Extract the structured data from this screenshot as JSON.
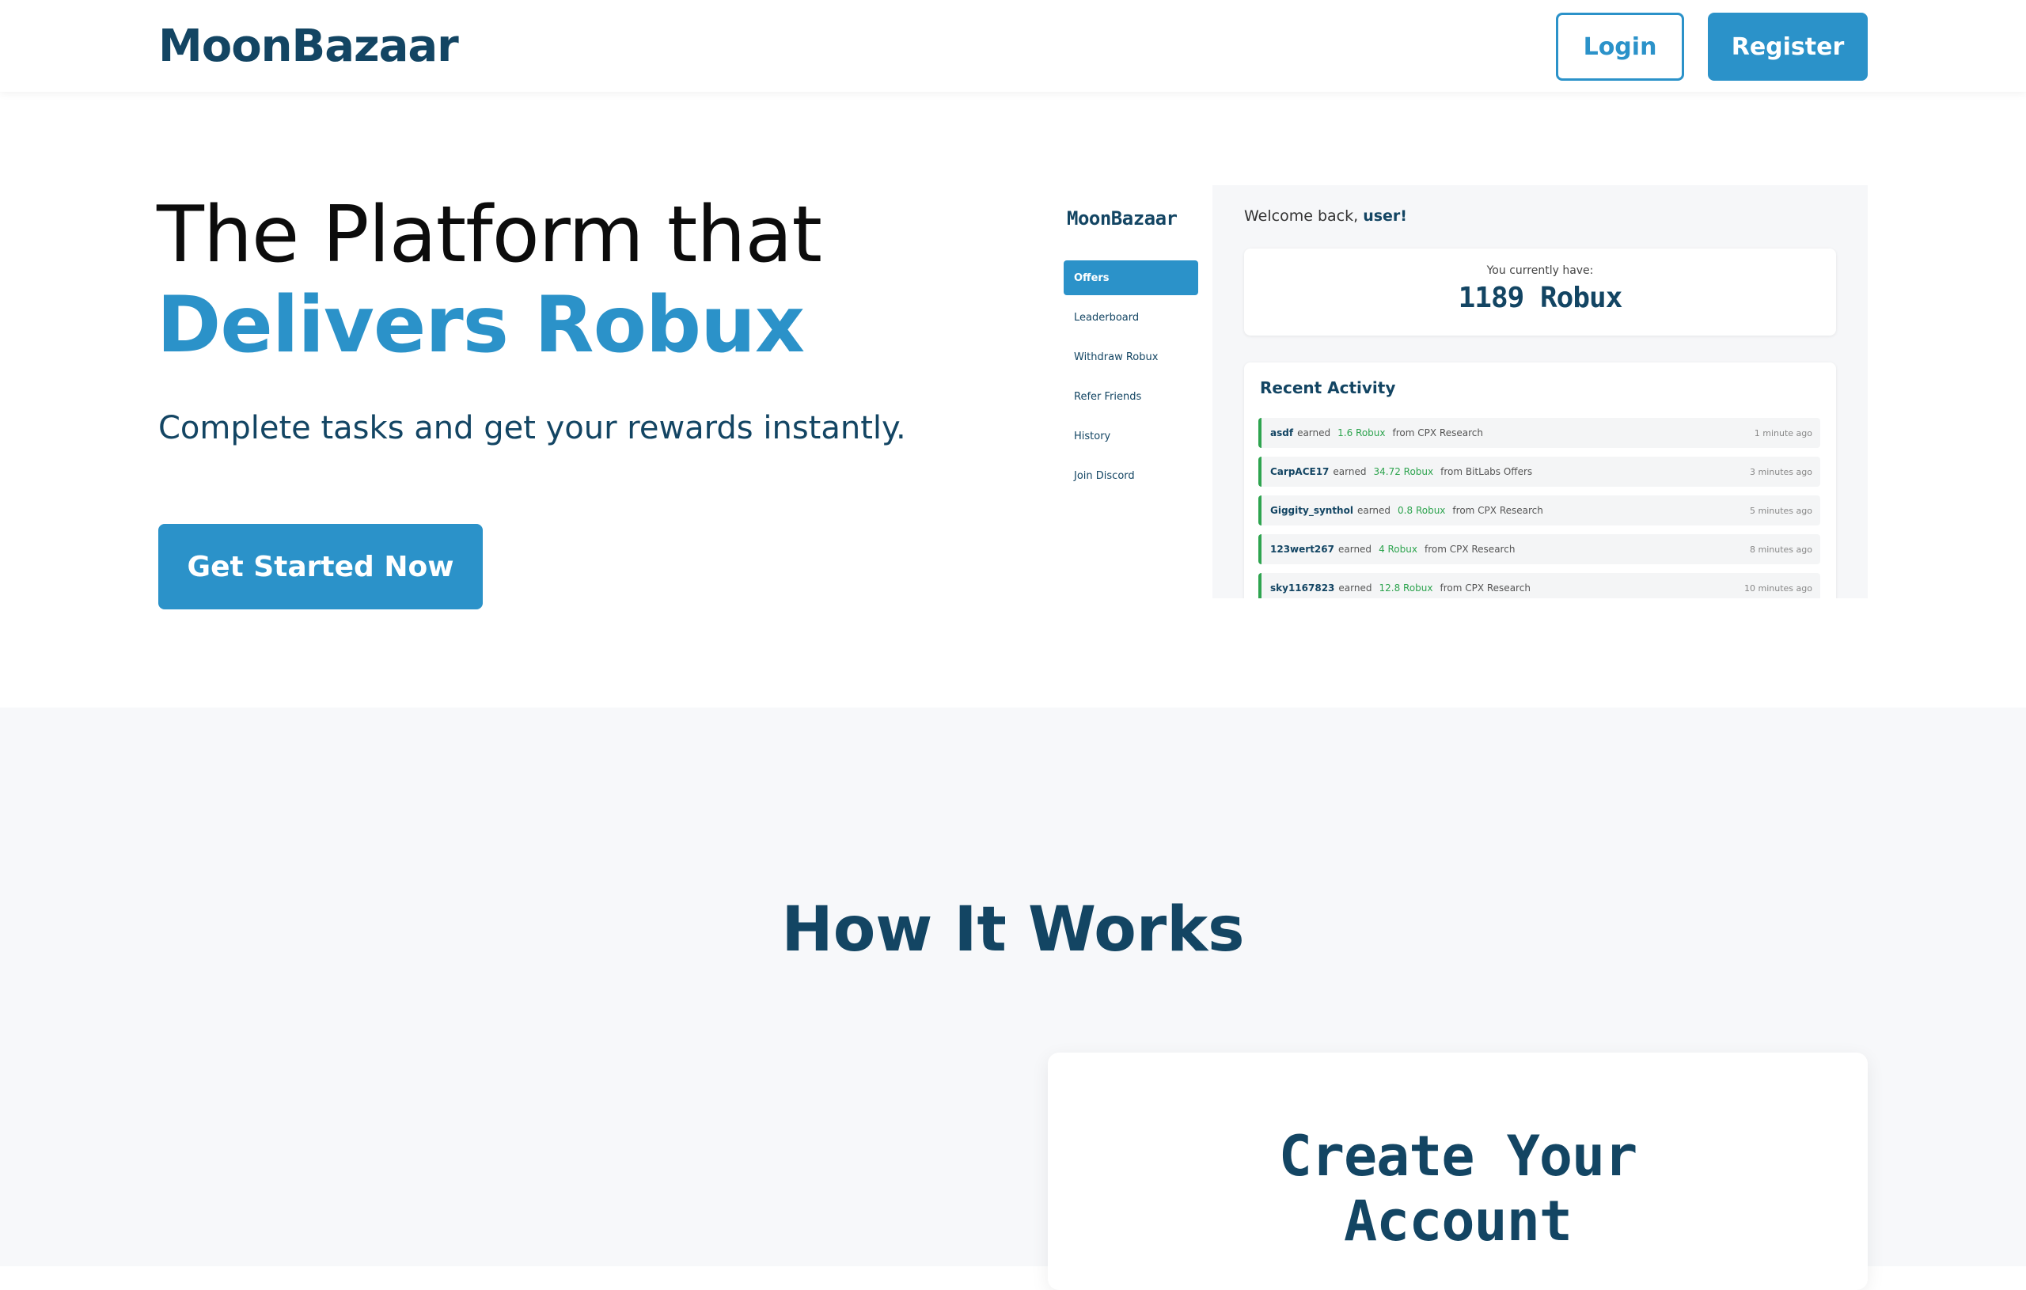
{
  "header": {
    "logo": "MoonBazaar",
    "login_label": "Login",
    "register_label": "Register"
  },
  "hero": {
    "title_line1": "The Platform that",
    "title_line2": "Delivers Robux",
    "subtitle": "Complete tasks and get your rewards instantly.",
    "cta_label": "Get Started Now"
  },
  "preview": {
    "logo": "MoonBazaar",
    "nav": [
      {
        "label": "Offers",
        "active": true
      },
      {
        "label": "Leaderboard",
        "active": false
      },
      {
        "label": "Withdraw Robux",
        "active": false
      },
      {
        "label": "Refer Friends",
        "active": false
      },
      {
        "label": "History",
        "active": false
      },
      {
        "label": "Join Discord",
        "active": false
      }
    ],
    "welcome_prefix": "Welcome back, ",
    "welcome_user": "user!",
    "balance_label": "You currently have:",
    "balance_value": "1189 Robux",
    "activity_title": "Recent Activity",
    "activity": [
      {
        "user": "asdf",
        "verb": "earned",
        "amount": "1.6 Robux",
        "source": "from CPX Research",
        "time": "1 minute ago"
      },
      {
        "user": "CarpACE17",
        "verb": "earned",
        "amount": "34.72 Robux",
        "source": "from BitLabs Offers",
        "time": "3 minutes ago"
      },
      {
        "user": "Giggity_synthol",
        "verb": "earned",
        "amount": "0.8 Robux",
        "source": "from CPX Research",
        "time": "5 minutes ago"
      },
      {
        "user": "123wert267",
        "verb": "earned",
        "amount": "4 Robux",
        "source": "from CPX Research",
        "time": "8 minutes ago"
      },
      {
        "user": "sky1167823",
        "verb": "earned",
        "amount": "12.8 Robux",
        "source": "from CPX Research",
        "time": "10 minutes ago"
      }
    ]
  },
  "how_it_works": {
    "title": "How It Works",
    "step1_line1": "Create Your",
    "step1_line2": "Account"
  },
  "colors": {
    "brand_dark": "#134563",
    "brand_blue": "#2b92c9",
    "success_green": "#2ea44f",
    "section_bg": "#f7f8fa"
  }
}
